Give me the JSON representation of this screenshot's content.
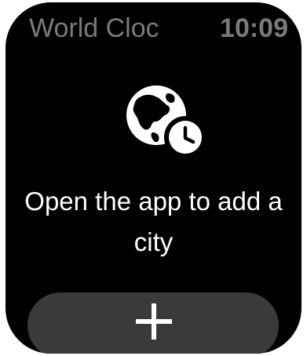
{
  "status_bar": {
    "app_title": "World Cloc",
    "time": "10:09"
  },
  "empty_state": {
    "icon": "globe-clock-icon",
    "message": "Open the app to add a city"
  },
  "actions": {
    "add_button_icon": "plus-icon"
  },
  "colors": {
    "background": "#000000",
    "header_text": "#7a7a7a",
    "body_text": "#ffffff",
    "button_bg": "#3a3a3a"
  }
}
